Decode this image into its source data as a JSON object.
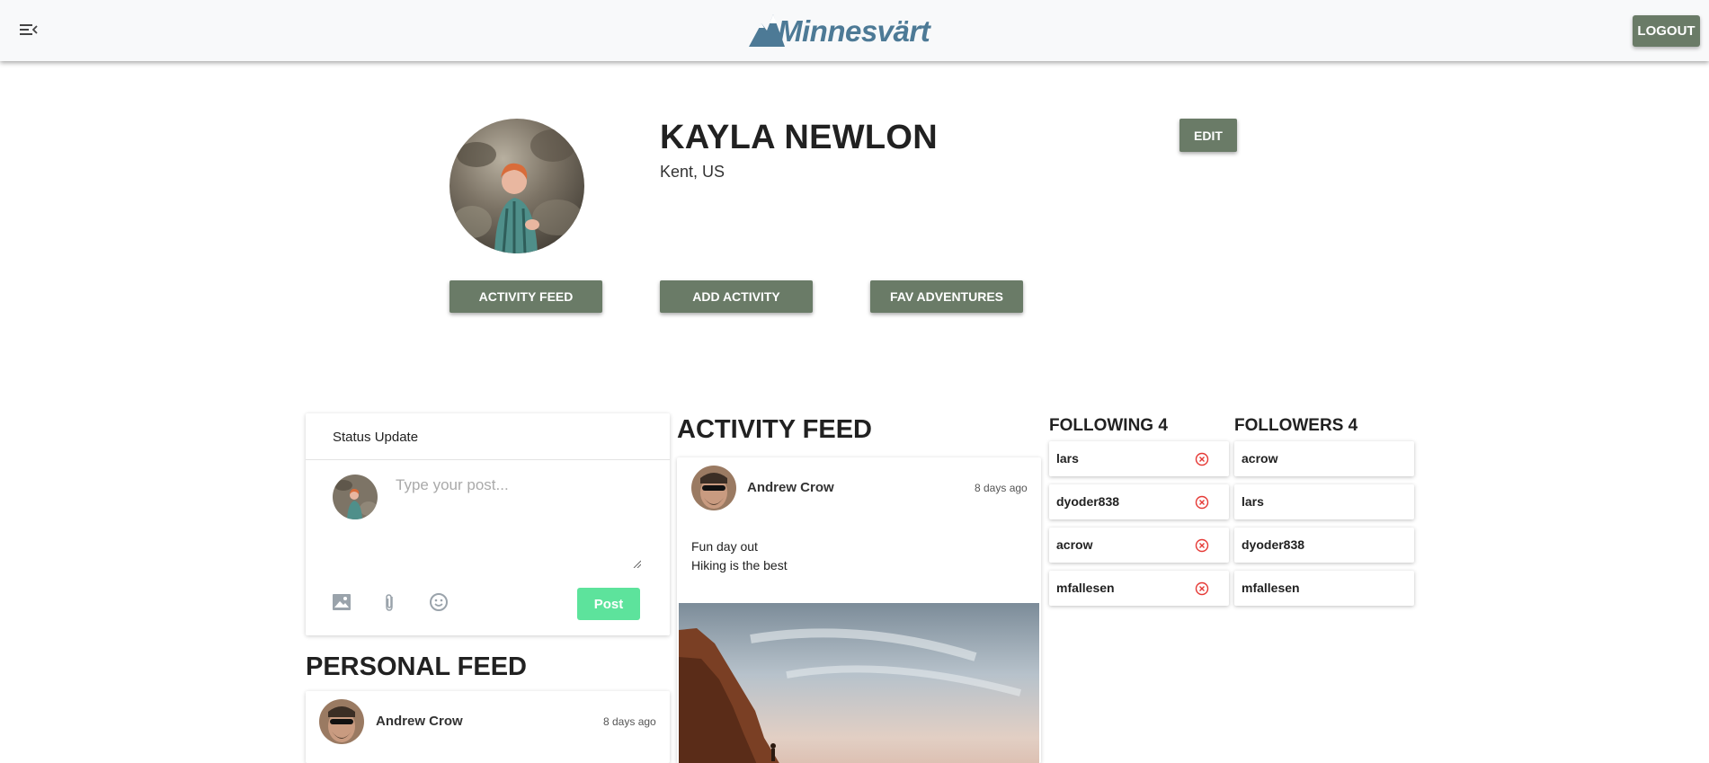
{
  "header": {
    "logo_text": "Minnesvärt",
    "logout_label": "LOGOUT",
    "menu_icon": "menu-collapse-icon"
  },
  "profile": {
    "name": "KAYLA NEWLON",
    "location": "Kent, US",
    "edit_label": "EDIT",
    "nav_buttons": [
      "ACTIVITY FEED",
      "ADD ACTIVITY",
      "FAV ADVENTURES"
    ]
  },
  "status_update": {
    "title": "Status Update",
    "placeholder": "Type your post...",
    "post_label": "Post",
    "tools": [
      "image-icon",
      "paperclip-icon",
      "smiley-icon"
    ],
    "post_button_color": "#5de39c"
  },
  "personal_feed": {
    "title": "PERSONAL FEED",
    "items": [
      {
        "author": "Andrew Crow",
        "time": "8 days ago"
      }
    ]
  },
  "activity_feed": {
    "title": "ACTIVITY FEED",
    "items": [
      {
        "author": "Andrew Crow",
        "time": "8 days ago",
        "lines": [
          "Fun day out",
          "Hiking is the best"
        ]
      }
    ]
  },
  "following": {
    "title": "FOLLOWING 4",
    "users": [
      "lars",
      "dyoder838",
      "acrow",
      "mfallesen"
    ]
  },
  "followers": {
    "title": "FOLLOWERS 4",
    "users": [
      "acrow",
      "lars",
      "dyoder838",
      "mfallesen"
    ]
  },
  "colors": {
    "primary_button": "#6a7b67",
    "brand": "#4d7a96",
    "unfollow": "#e53935"
  }
}
